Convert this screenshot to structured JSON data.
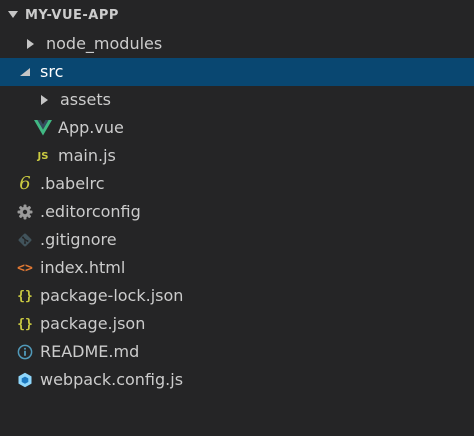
{
  "explorer": {
    "title": "MY-VUE-APP",
    "items": [
      {
        "label": "node_modules",
        "icon": "chevron-right-icon"
      },
      {
        "label": "src",
        "icon": "chevron-down-icon"
      },
      {
        "label": "assets",
        "icon": "chevron-right-icon"
      },
      {
        "label": "App.vue",
        "icon": "vue-icon"
      },
      {
        "label": "main.js",
        "icon": "js-icon",
        "badge": "JS"
      },
      {
        "label": ".babelrc",
        "icon": "babel-icon",
        "badge": "6"
      },
      {
        "label": ".editorconfig",
        "icon": "gear-icon"
      },
      {
        "label": ".gitignore",
        "icon": "git-icon"
      },
      {
        "label": "index.html",
        "icon": "html-icon",
        "badge": "<>"
      },
      {
        "label": "package-lock.json",
        "icon": "json-icon",
        "badge": "{}"
      },
      {
        "label": "package.json",
        "icon": "json-icon",
        "badge": "{}"
      },
      {
        "label": "README.md",
        "icon": "info-icon"
      },
      {
        "label": "webpack.config.js",
        "icon": "webpack-icon"
      }
    ]
  },
  "colors": {
    "background": "#252526",
    "selected": "#094771",
    "text": "#cccccc",
    "vue_green": "#41b883",
    "json_yellow": "#cbcb41",
    "html_orange": "#e37933",
    "info_blue": "#519aba"
  }
}
